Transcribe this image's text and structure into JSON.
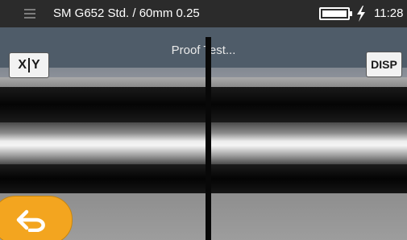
{
  "status_bar": {
    "menu_icon": "menu-icon",
    "title": "SM G652 Std. / 60mm 0.25",
    "battery_icon": "battery-full-icon",
    "charging_icon": "charging-bolt-icon",
    "time": "11:28"
  },
  "camera_view": {
    "banner": "Proof Test...",
    "xy_button_label_x": "X",
    "xy_button_label_y": "Y",
    "disp_button_label": "DISP"
  },
  "back_button": {
    "icon": "back-arrow-icon"
  },
  "colors": {
    "status_bar_bg": "#2b2b2b",
    "header_bg": "#4f5c69",
    "back_button": "#f3a51f"
  }
}
